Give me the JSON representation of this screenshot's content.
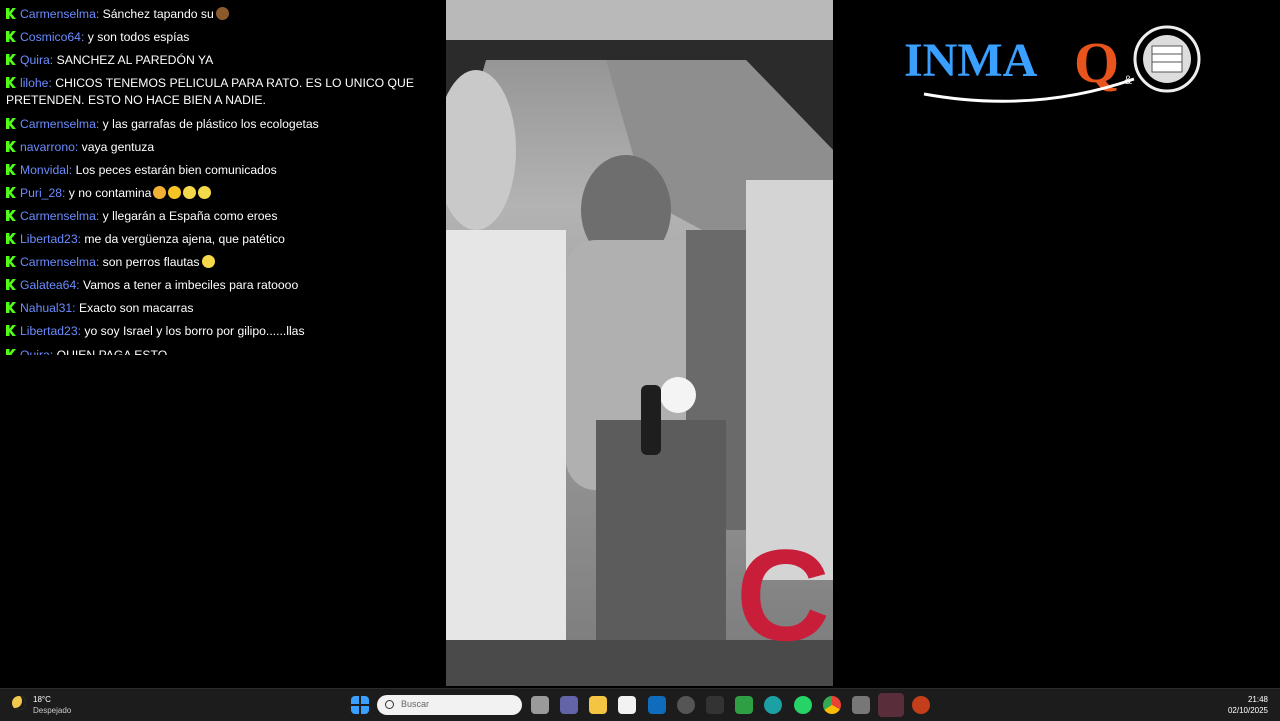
{
  "chat": {
    "messages": [
      {
        "user": "Carmenselma:",
        "text": "Sánchez tapando su",
        "emoji": [
          "poop-emoji"
        ]
      },
      {
        "user": "Cosmico64:",
        "text": "y son todos espías",
        "emoji": []
      },
      {
        "user": "Quira:",
        "text": "SANCHEZ AL PAREDÓN YA",
        "emoji": []
      },
      {
        "user": "lilohe:",
        "text": "CHICOS TENEMOS PELICULA PARA RATO. ES LO UNICO QUE PRETENDEN. ESTO NO HACE BIEN A NADIE.",
        "emoji": []
      },
      {
        "user": "Carmenselma:",
        "text": "y las garrafas de plástico los ecologetas",
        "emoji": []
      },
      {
        "user": "navarrono:",
        "text": "vaya gentuza",
        "emoji": []
      },
      {
        "user": "Monvidal:",
        "text": "Los peces estarán bien comunicados",
        "emoji": []
      },
      {
        "user": "Puri_28:",
        "text": "y no contamina",
        "emoji": [
          "person-shrug-emoji",
          "grin-emoji",
          "rofl-emoji",
          "rofl-emoji"
        ]
      },
      {
        "user": "Carmenselma:",
        "text": "y llegarán a España como eroes",
        "emoji": []
      },
      {
        "user": "Libertad23:",
        "text": "me da vergüenza ajena, que patético",
        "emoji": []
      },
      {
        "user": "Carmenselma:",
        "text": "son perros flautas",
        "emoji": [
          "rofl-emoji"
        ]
      },
      {
        "user": "Galatea64:",
        "text": "Vamos a tener a imbeciles para ratoooo",
        "emoji": []
      },
      {
        "user": "Nahual31:",
        "text": "Exacto son macarras",
        "emoji": []
      },
      {
        "user": "Libertad23:",
        "text": "yo soy Israel y los borro por gilipo......llas",
        "emoji": []
      },
      {
        "user": "Quira:",
        "text": "QUIEN PAGA ESTO",
        "emoji": []
      }
    ],
    "colors": {
      "user": "#6b8cff",
      "badge": "#53fc18"
    }
  },
  "logo": {
    "text": "INMAQ",
    "ampersand": "&",
    "brand_color": "#3aa0ff",
    "accent": "#e8541c"
  },
  "video": {
    "watermark": "C",
    "watermark_color": "#c81e3a"
  },
  "taskbar": {
    "weather_temp": "18°C",
    "weather_desc": "Despejado",
    "search_placeholder": "Buscar",
    "time": "21:48",
    "date": "02/10/2025",
    "apps": [
      "windows-start-icon",
      "task-view-icon",
      "teams-icon",
      "file-explorer-icon",
      "microsoft-store-icon",
      "outlook-icon",
      "app-icon",
      "app-icon-2",
      "app-icon-green",
      "edge-icon",
      "whatsapp-icon",
      "chrome-icon",
      "app-icon-3",
      "app-icon-active",
      "powerpoint-icon"
    ]
  }
}
